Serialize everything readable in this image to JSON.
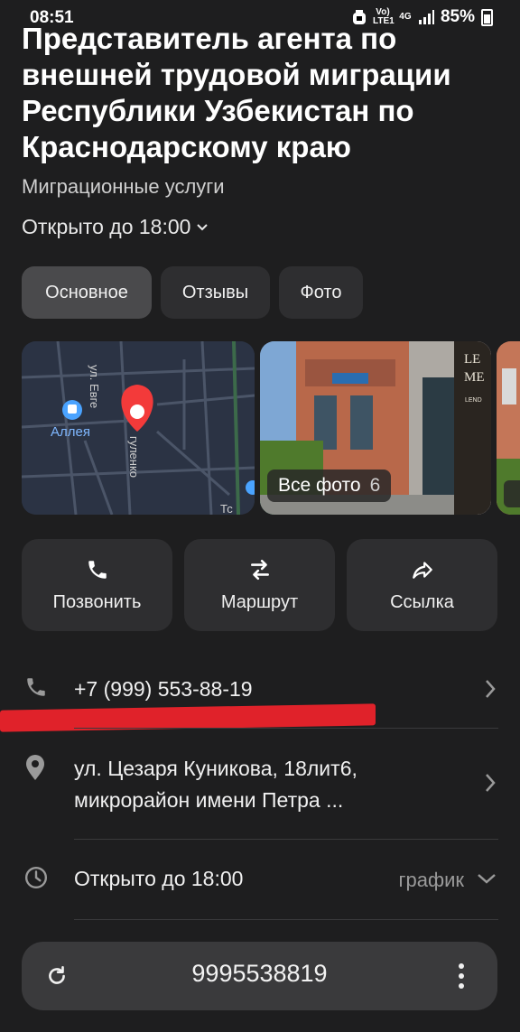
{
  "status": {
    "time": "08:51",
    "network": "Vo) LTE1",
    "net_type": "4G",
    "battery": "85%"
  },
  "place": {
    "title": "Представитель агента по внешней трудовой миграции Республики Узбекистан по Краснодарскому краю",
    "category": "Миграционные услуги",
    "hours": "Открыто до 18:00"
  },
  "tabs": [
    {
      "label": "Основное",
      "active": true
    },
    {
      "label": "Отзывы",
      "active": false
    },
    {
      "label": "Фото",
      "active": false
    }
  ],
  "map": {
    "poi_label": "Аллея",
    "street_1": "ул. Евге",
    "street_2": "гуленко",
    "street_3": "Тс"
  },
  "photos": {
    "label": "Все фото",
    "count": "6",
    "sign": "LE ME",
    "sign_small": "LEND"
  },
  "actions": [
    {
      "label": "Позвонить",
      "icon": "phone-icon"
    },
    {
      "label": "Маршрут",
      "icon": "route-icon"
    },
    {
      "label": "Ссылка",
      "icon": "share-icon"
    }
  ],
  "contact": {
    "phone": "+7 (999) 553-88-19",
    "address_line1": "ул. Цезаря Куникова, 18лит6,",
    "address_line2": "микрорайон имени Петра ...",
    "hours": "Открыто до 18:00",
    "schedule_label": "график"
  },
  "search": {
    "query": "9995538819"
  },
  "colors": {
    "background": "#1e1e1f",
    "card": "#2e2e30",
    "accent_red": "#e0222a",
    "pin": "#f33a3a"
  }
}
